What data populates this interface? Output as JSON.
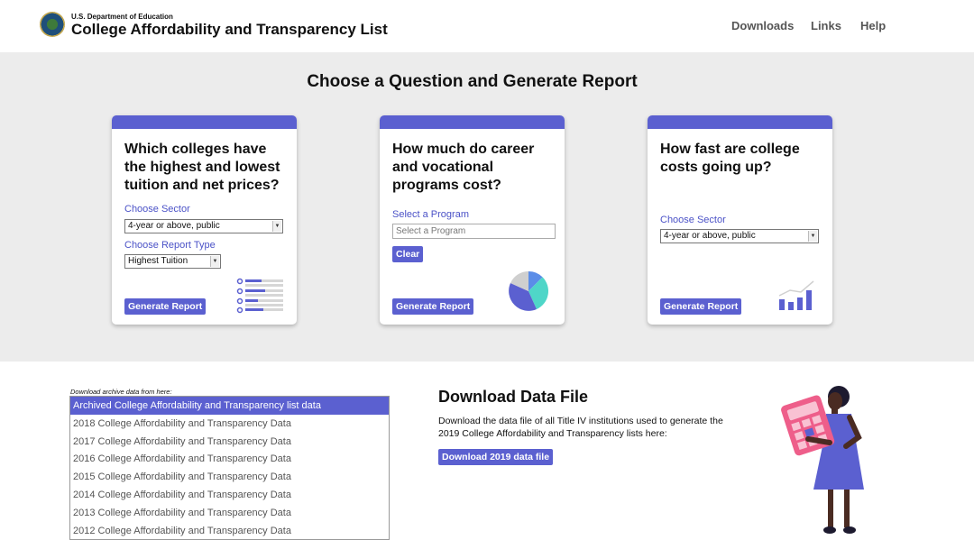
{
  "header": {
    "department": "U.S. Department of Education",
    "title": "College Affordability and Transparency List",
    "nav": [
      "Downloads",
      "Links",
      "Help"
    ]
  },
  "questions": {
    "heading": "Choose a Question and Generate Report",
    "cards": [
      {
        "question": "Which colleges have the highest and lowest tuition and net prices?",
        "sector_label": "Choose Sector",
        "sector_value": "4-year or above, public",
        "report_type_label": "Choose Report Type",
        "report_type_value": "Highest Tuition",
        "button": "Generate Report",
        "icon": "list-icon"
      },
      {
        "question": "How much do career and vocational programs cost?",
        "program_label": "Select a Program",
        "program_placeholder": "Select a Program",
        "clear_button": "Clear",
        "button": "Generate Report",
        "icon": "pie-chart-icon"
      },
      {
        "question": "How fast are college costs going up?",
        "sector_label": "Choose Sector",
        "sector_value": "4-year or above, public",
        "button": "Generate Report",
        "icon": "bar-chart-icon"
      }
    ]
  },
  "archive": {
    "caption": "Download archive data from here:",
    "items": [
      "Archived College Affordability and Transparency list data",
      "2018 College Affordability and Transparency Data",
      "2017 College Affordability and Transparency Data",
      "2016 College Affordability and Transparency Data",
      "2015 College Affordability and Transparency Data",
      "2014 College Affordability and Transparency Data",
      "2013 College Affordability and Transparency Data",
      "2012 College Affordability and Transparency Data"
    ],
    "selected_index": 0
  },
  "download": {
    "title": "Download Data File",
    "description": "Download the data file of all Title IV institutions used to generate the 2019 College Affordability and Transparency lists here:",
    "button": "Download 2019 data file"
  },
  "colors": {
    "accent": "#5b60d0",
    "label": "#4b52c7",
    "section_bg": "#ececec",
    "illustration_pink": "#ee5e8a",
    "pie_teal": "#4fd6c8"
  }
}
